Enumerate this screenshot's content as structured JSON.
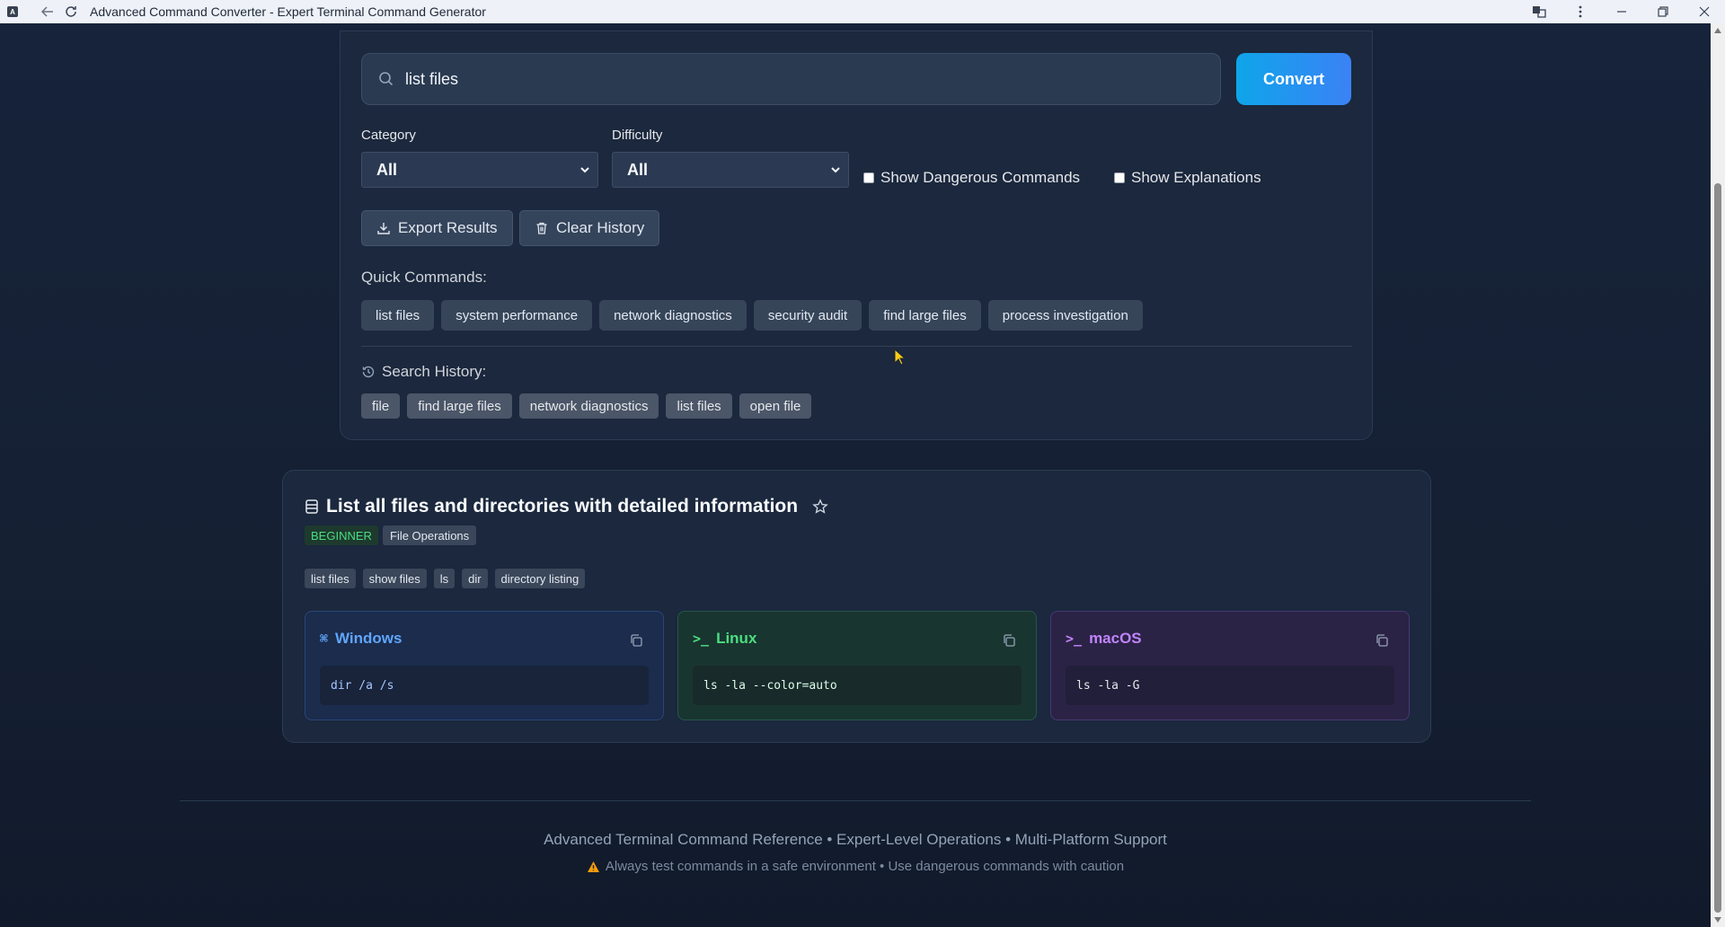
{
  "window": {
    "title": "Advanced Command Converter - Expert Terminal Command Generator",
    "app_icon_letter": "A"
  },
  "search": {
    "value": "list files",
    "convert_label": "Convert"
  },
  "filters": {
    "category_label": "Category",
    "category_value": "All",
    "difficulty_label": "Difficulty",
    "difficulty_value": "All",
    "show_dangerous_label": "Show Dangerous Commands",
    "show_explanations_label": "Show Explanations"
  },
  "actions": {
    "export_label": "Export Results",
    "clear_label": "Clear History"
  },
  "quick_commands": {
    "title": "Quick Commands:",
    "items": [
      "list files",
      "system performance",
      "network diagnostics",
      "security audit",
      "find large files",
      "process investigation"
    ]
  },
  "history": {
    "title": "Search History:",
    "items": [
      "file",
      "find large files",
      "network diagnostics",
      "list files",
      "open file"
    ]
  },
  "result": {
    "title": "List all files and directories with detailed information",
    "level": "BEGINNER",
    "category": "File Operations",
    "tags": [
      "list files",
      "show files",
      "ls",
      "dir",
      "directory listing"
    ],
    "platforms": {
      "windows": {
        "name": "Windows",
        "icon": "⌘",
        "command": "dir /a /s"
      },
      "linux": {
        "name": "Linux",
        "icon": ">_",
        "command": "ls -la --color=auto"
      },
      "macos": {
        "name": "macOS",
        "icon": ">_",
        "command": "ls -la -G"
      }
    }
  },
  "footer": {
    "main": "Advanced Terminal Command Reference • Expert-Level Operations • Multi-Platform Support",
    "warning": "Always test commands in a safe environment • Use dangerous commands with caution"
  },
  "colors": {
    "accent": "#0ea5e9",
    "windows": "#60a5fa",
    "linux": "#4ade80",
    "macos": "#c084fc",
    "beginner": "#4ade80"
  }
}
